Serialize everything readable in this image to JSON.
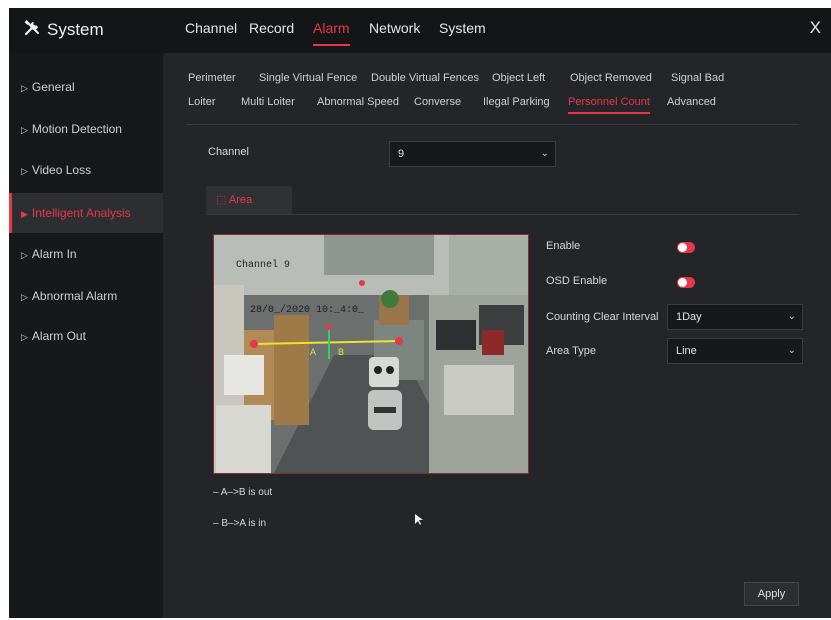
{
  "app": {
    "title": "System",
    "icon": "tools-icon"
  },
  "top_nav": [
    {
      "label": "Channel",
      "active": false
    },
    {
      "label": "Record",
      "active": false
    },
    {
      "label": "Alarm",
      "active": true
    },
    {
      "label": "Network",
      "active": false
    },
    {
      "label": "System",
      "active": false
    }
  ],
  "close_label": "X",
  "sidebar": {
    "items": [
      {
        "label": "General",
        "active": false
      },
      {
        "label": "Motion Detection",
        "active": false
      },
      {
        "label": "Video Loss",
        "active": false
      },
      {
        "label": "Intelligent Analysis",
        "active": true
      },
      {
        "label": "Alarm In",
        "active": false
      },
      {
        "label": "Abnormal Alarm",
        "active": false
      },
      {
        "label": "Alarm Out",
        "active": false
      }
    ]
  },
  "subtabs": {
    "row1": [
      "Perimeter",
      "Single Virtual Fence",
      "Double Virtual Fences",
      "Object Left",
      "Object Removed",
      "Signal Bad"
    ],
    "row2": [
      "Loiter",
      "Multi Loiter",
      "Abnormal Speed",
      "Converse",
      "Ilegal Parking",
      "Personnel Count",
      "Advanced"
    ],
    "active": "Personnel Count"
  },
  "channel": {
    "label": "Channel",
    "value": "9"
  },
  "area_tab": {
    "label": "Area",
    "icon": "area-select-icon"
  },
  "video": {
    "overlay_title": "Channel 9",
    "overlay_timestamp": "28/0_/2020 10:_4:0_",
    "line_markers": [
      "A",
      "B"
    ]
  },
  "settings": {
    "enable": {
      "label": "Enable",
      "on": true
    },
    "osd_enable": {
      "label": "OSD Enable",
      "on": true
    },
    "counting_clear_interval": {
      "label": "Counting Clear Interval",
      "value": "1Day"
    },
    "area_type": {
      "label": "Area Type",
      "value": "Line"
    }
  },
  "legend": [
    "– A–>B is out",
    "– B–>A is in"
  ],
  "apply_label": "Apply",
  "colors": {
    "accent": "#e8364a",
    "panel": "#232528",
    "sidebar": "#17181a",
    "topbar": "#141516"
  }
}
